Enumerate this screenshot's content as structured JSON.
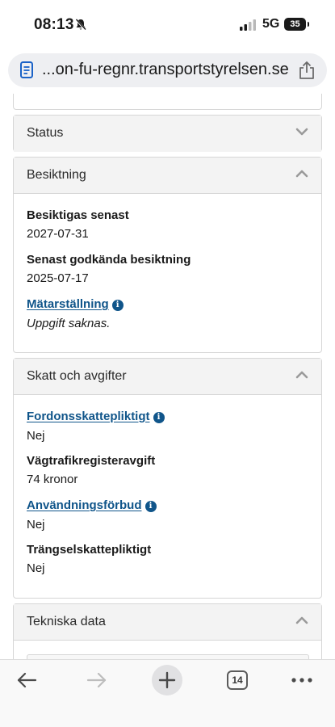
{
  "status_bar": {
    "time": "08:13",
    "network": "5G",
    "battery": "35"
  },
  "browser": {
    "url": "...on-fu-regnr.transportstyrelsen.se",
    "tab_count": "14"
  },
  "panels": {
    "status": {
      "title": "Status"
    },
    "inspection": {
      "title": "Besiktning",
      "next_label": "Besiktigas senast",
      "next_value": "2027-07-31",
      "last_label": "Senast godkända besiktning",
      "last_value": "2025-07-17",
      "odometer_label": "Mätarställning",
      "odometer_value": "Uppgift saknas."
    },
    "tax": {
      "title": "Skatt och avgifter",
      "vehicle_tax_label": "Fordonsskattepliktigt",
      "vehicle_tax_value": "Nej",
      "road_fee_label": "Vägtrafikregisteravgift",
      "road_fee_value": "74 kronor",
      "usage_ban_label": "Användningsförbud",
      "usage_ban_value": "Nej",
      "congestion_label": "Trängselskattepliktigt",
      "congestion_value": "Nej"
    },
    "technical": {
      "title": "Tekniska data"
    }
  },
  "icons": {
    "info": "i"
  }
}
